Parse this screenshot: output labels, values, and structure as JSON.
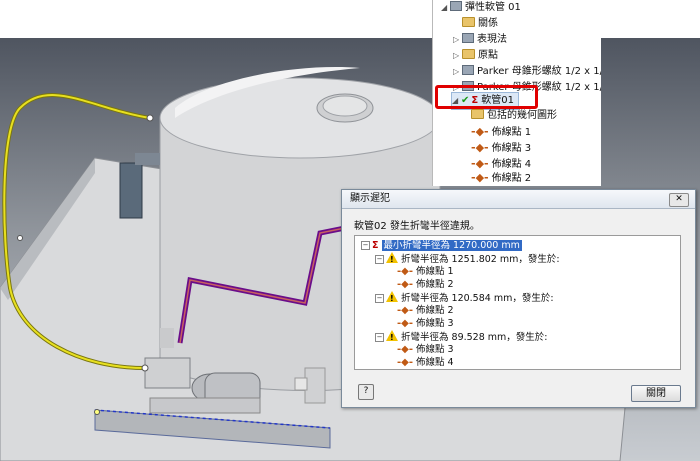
{
  "browser": {
    "root_label": "彈性軟管 01",
    "items": [
      {
        "label": "關係",
        "icon": "folder-icon"
      },
      {
        "label": "表現法",
        "icon": "representations-icon"
      },
      {
        "label": "原點",
        "icon": "folder-icon"
      },
      {
        "label": "Parker 母錐形螺紋 1/2 x 1/",
        "icon": "fitting-icon"
      },
      {
        "label": "Parker 母錐形螺紋 1/2 x 1/",
        "icon": "fitting-icon"
      }
    ],
    "hose_label": "軟管01",
    "hose_children": [
      "包括的幾何圖形",
      "佈線點 1",
      "佈線點 3",
      "佈線點 4",
      "佈線點 2"
    ]
  },
  "dialog": {
    "title": "顯示遲犯",
    "summary": "軟管02 發生折彎半徑違規。",
    "tree": {
      "root": "最小折彎半徑為 1270.000 mm",
      "groups": [
        {
          "text": "折彎半徑為 1251.802 mm，發生於:",
          "points": [
            "佈線點 1",
            "佈線點 2"
          ]
        },
        {
          "text": "折彎半徑為 120.584 mm，發生於:",
          "points": [
            "佈線點 2",
            "佈線點 3"
          ]
        },
        {
          "text": "折彎半徑為 89.528 mm，發生於:",
          "points": [
            "佈線點 3",
            "佈線點 4"
          ]
        }
      ]
    },
    "close_label": "關閉",
    "help_label": "?",
    "close_x": "✕"
  },
  "colors": {
    "highlight": "#e00000",
    "selection": "#316ac5",
    "warning": "#f2c200",
    "hose": "#e8e020",
    "route": "#6a0d8a"
  }
}
